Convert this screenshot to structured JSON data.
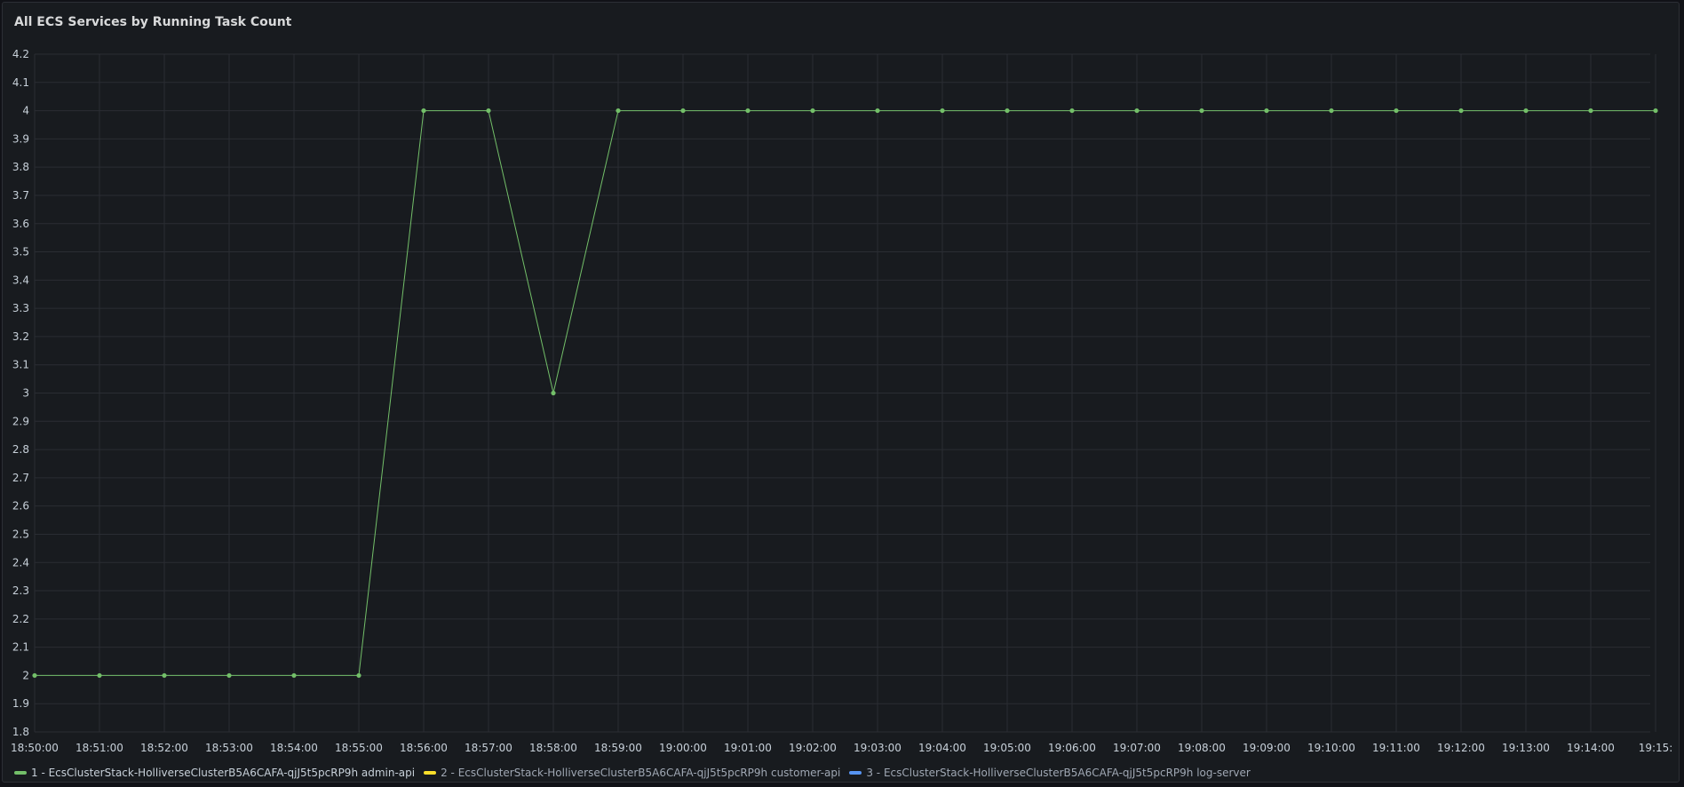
{
  "panel": {
    "title": "All ECS Services by Running Task Count"
  },
  "chart_data": {
    "type": "line",
    "title": "All ECS Services by Running Task Count",
    "xlabel": "",
    "ylabel": "",
    "ylim": [
      1.8,
      4.2
    ],
    "yticks": [
      "1.8",
      "1.9",
      "2",
      "2.1",
      "2.2",
      "2.3",
      "2.4",
      "2.5",
      "2.6",
      "2.7",
      "2.8",
      "2.9",
      "3",
      "3.1",
      "3.2",
      "3.3",
      "3.4",
      "3.5",
      "3.6",
      "3.7",
      "3.8",
      "3.9",
      "4",
      "4.1",
      "4.2"
    ],
    "x": [
      "18:50:00",
      "18:51:00",
      "18:52:00",
      "18:53:00",
      "18:54:00",
      "18:55:00",
      "18:56:00",
      "18:57:00",
      "18:58:00",
      "18:59:00",
      "19:00:00",
      "19:01:00",
      "19:02:00",
      "19:03:00",
      "19:04:00",
      "19:05:00",
      "19:06:00",
      "19:07:00",
      "19:08:00",
      "19:09:00",
      "19:10:00",
      "19:11:00",
      "19:12:00",
      "19:13:00",
      "19:14:00",
      "19:15:"
    ],
    "grid": true,
    "legend_placement": "bottom-left",
    "series": [
      {
        "name": "1 - EcsClusterStack-HolliverseClusterB5A6CAFA-qjJ5t5pcRP9h admin-api",
        "color": "#73bf69",
        "values": [
          2,
          2,
          2,
          2,
          2,
          2,
          4,
          4,
          3,
          4,
          4,
          4,
          4,
          4,
          4,
          4,
          4,
          4,
          4,
          4,
          4,
          4,
          4,
          4,
          4,
          4
        ]
      },
      {
        "name": "2 - EcsClusterStack-HolliverseClusterB5A6CAFA-qjJ5t5pcRP9h customer-api",
        "color": "#fade2a",
        "values": []
      },
      {
        "name": "3 - EcsClusterStack-HolliverseClusterB5A6CAFA-qjJ5t5pcRP9h log-server",
        "color": "#5794f2",
        "values": []
      }
    ]
  }
}
